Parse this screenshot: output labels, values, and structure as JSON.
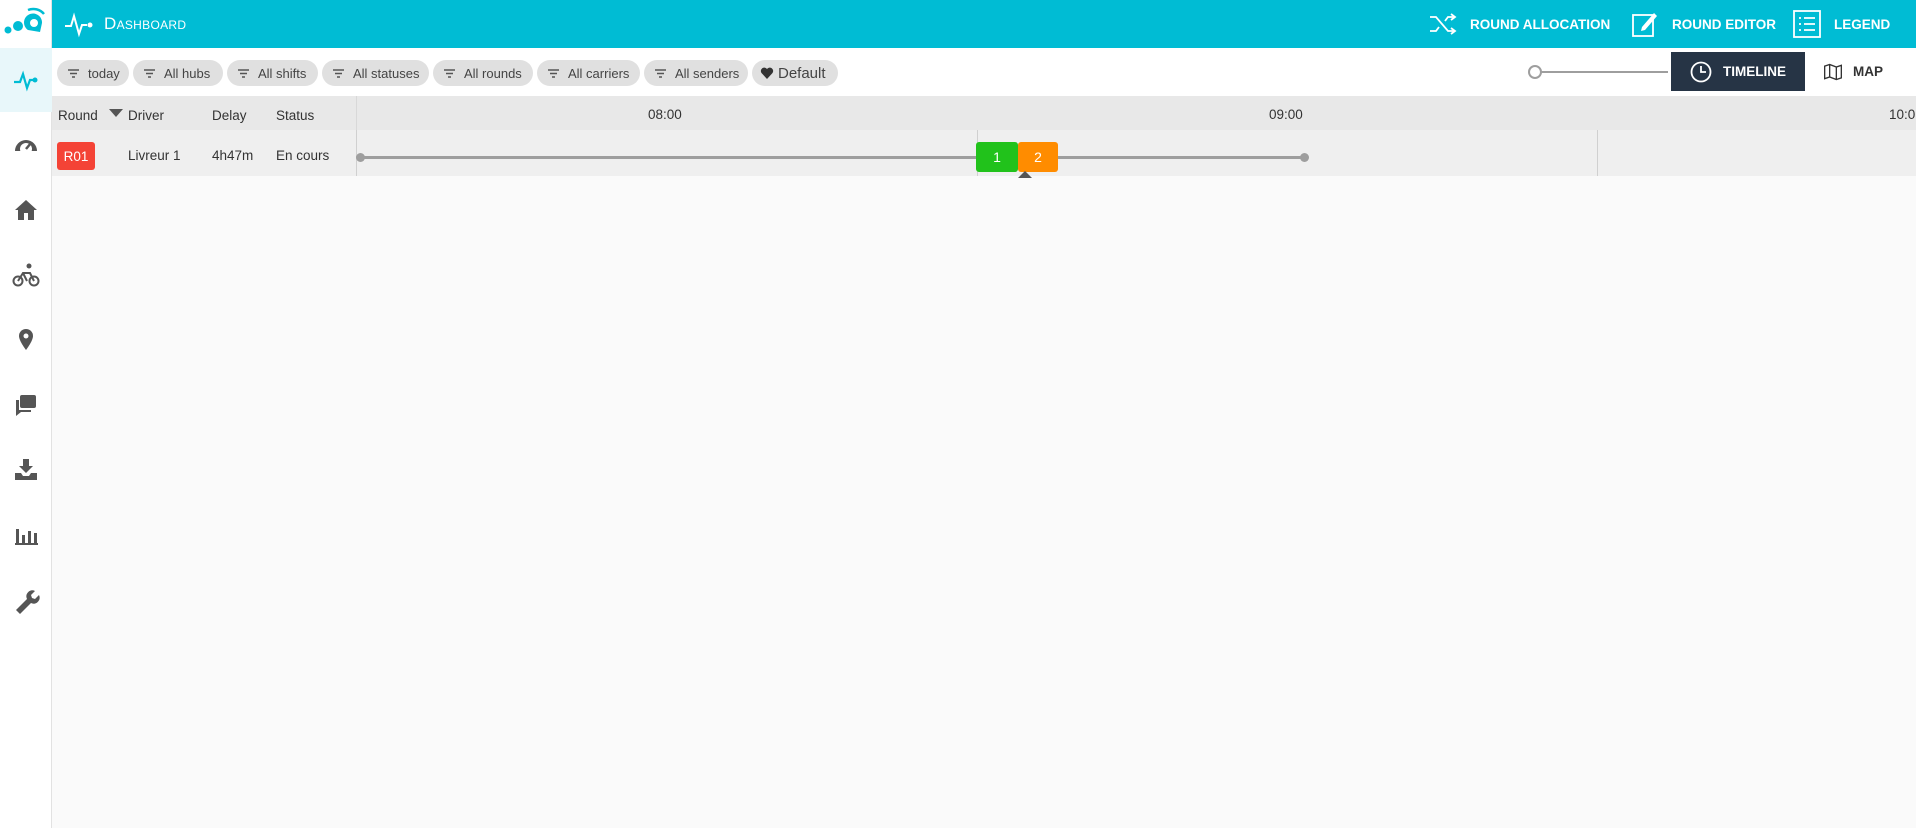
{
  "header": {
    "title": "Dashboard",
    "round_allocation": "ROUND ALLOCATION",
    "round_editor": "ROUND EDITOR",
    "legend": "LEGEND"
  },
  "filters": [
    {
      "label": "today"
    },
    {
      "label": "All hubs"
    },
    {
      "label": "All shifts"
    },
    {
      "label": "All statuses"
    },
    {
      "label": "All rounds"
    },
    {
      "label": "All carriers"
    },
    {
      "label": "All senders"
    }
  ],
  "default_filter": "Default",
  "views": {
    "timeline": "TIMELINE",
    "map": "MAP",
    "active": "timeline"
  },
  "table": {
    "columns": {
      "round": "Round",
      "driver": "Driver",
      "delay": "Delay",
      "status": "Status"
    },
    "ticks": [
      "08:00",
      "09:00",
      "10:0"
    ],
    "rows": [
      {
        "round": "R01",
        "driver": "Livreur 1",
        "delay": "4h47m",
        "status": "En cours",
        "stops": [
          {
            "label": "1",
            "color": "#21c21b"
          },
          {
            "label": "2",
            "color": "#ff8c00"
          }
        ]
      }
    ]
  },
  "colors": {
    "accent": "#00bcd4",
    "round_badge": "#f44336",
    "active_view": "#263445"
  },
  "icons": {
    "sidebar": [
      "pulse-icon",
      "speedometer-icon",
      "home-icon",
      "bicycle-icon",
      "location-pin-icon",
      "chat-icon",
      "inbox-download-icon",
      "bar-chart-icon",
      "wrench-icon"
    ]
  }
}
